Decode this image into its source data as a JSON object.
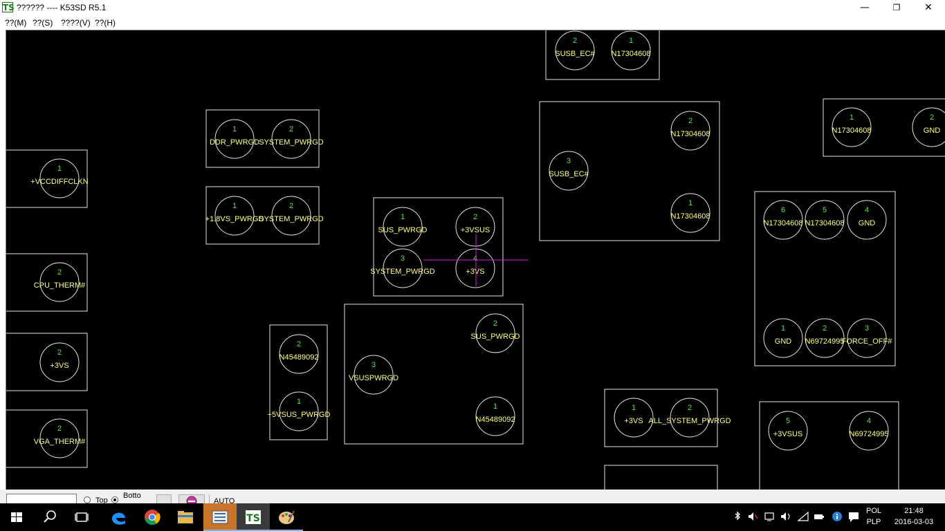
{
  "window": {
    "title": "?????? ---- K53SD R5.1",
    "logo_text": "TS",
    "minimize_glyph": "—",
    "maximize_glyph": "❐",
    "close_glyph": "✕"
  },
  "menu": [
    {
      "label": "??(M)"
    },
    {
      "label": "??(S)"
    },
    {
      "label": "????(V)"
    },
    {
      "label": "??(H)"
    }
  ],
  "colors": {
    "canvas": "#000000",
    "outline": "#e6e6e6",
    "pin_number": "#58e058",
    "net_name": "#ffff80",
    "crosshair": "#d020d0"
  },
  "components": [
    {
      "pins": [
        {
          "num": "2",
          "net": "SUSB_EC#"
        },
        {
          "num": "1",
          "net": "N17304608"
        }
      ]
    },
    {
      "pins": [
        {
          "num": "1",
          "net": "DDR_PWRGD"
        },
        {
          "num": "2",
          "net": "SYSTEM_PWRGD"
        }
      ]
    },
    {
      "pins": [
        {
          "num": "1",
          "net": "+1.8VS_PWRGD"
        },
        {
          "num": "2",
          "net": "SYSTEM_PWRGD"
        }
      ]
    },
    {
      "pins": [
        {
          "num": "1",
          "net": "+VCCDIFFCLKN"
        }
      ]
    },
    {
      "pins": [
        {
          "num": "2",
          "net": "CPU_THERM#"
        }
      ]
    },
    {
      "pins": [
        {
          "num": "2",
          "net": "+3VS"
        }
      ]
    },
    {
      "pins": [
        {
          "num": "2",
          "net": "VGA_THERM#"
        }
      ]
    },
    {
      "pins": [
        {
          "num": "1",
          "net": "SUS_PWRGD"
        },
        {
          "num": "2",
          "net": "+3VSUS"
        },
        {
          "num": "3",
          "net": "SYSTEM_PWRGD"
        },
        {
          "num": "4",
          "net": "+3VS"
        }
      ]
    },
    {
      "pins": [
        {
          "num": "2",
          "net": "N45489092"
        },
        {
          "num": "1",
          "net": "+5VSUS_PWRGD"
        }
      ]
    },
    {
      "pins": [
        {
          "num": "2",
          "net": "SUS_PWRGD"
        },
        {
          "num": "3",
          "net": "VSUSPWRGD"
        },
        {
          "num": "1",
          "net": "N45489092"
        }
      ]
    },
    {
      "pins": [
        {
          "num": "2",
          "net": "N17304608"
        },
        {
          "num": "3",
          "net": "SUSB_EC#"
        },
        {
          "num": "1",
          "net": "N17304608"
        }
      ]
    },
    {
      "pins": [
        {
          "num": "1",
          "net": "N17304608"
        },
        {
          "num": "2",
          "net": "GND"
        }
      ]
    },
    {
      "pins": [
        {
          "num": "6",
          "net": "N17304608"
        },
        {
          "num": "5",
          "net": "N17304608"
        },
        {
          "num": "4",
          "net": "GND"
        },
        {
          "num": "1",
          "net": "GND"
        },
        {
          "num": "2",
          "net": "N69724995"
        },
        {
          "num": "3",
          "net": "FORCE_OFF#"
        }
      ]
    },
    {
      "pins": [
        {
          "num": "1",
          "net": "+3VS"
        },
        {
          "num": "2",
          "net": "ALL_SYSTEM_PWRGD"
        }
      ]
    },
    {
      "pins": []
    },
    {
      "pins": [
        {
          "num": "5",
          "net": "+3VSUS"
        },
        {
          "num": "4",
          "net": "N69724995"
        }
      ]
    }
  ],
  "toolbar": {
    "search_value": "",
    "top_label": "Top",
    "bottom_label": "Botto",
    "top_checked": false,
    "bottom_checked": true,
    "auto_label": "AUTO"
  },
  "taskbar": {
    "apps": [
      {
        "icon": "windows-start-icon"
      },
      {
        "icon": "search-icon"
      },
      {
        "icon": "task-view-icon"
      },
      {
        "icon": "edge-icon"
      },
      {
        "icon": "chrome-icon"
      },
      {
        "icon": "file-explorer-icon"
      },
      {
        "icon": "list-app-icon"
      },
      {
        "icon": "ts-app-icon"
      },
      {
        "icon": "paint-icon"
      }
    ],
    "language_top": "POL",
    "language_bottom": "PLP",
    "time": "21:48",
    "date": "2016-03-03"
  }
}
